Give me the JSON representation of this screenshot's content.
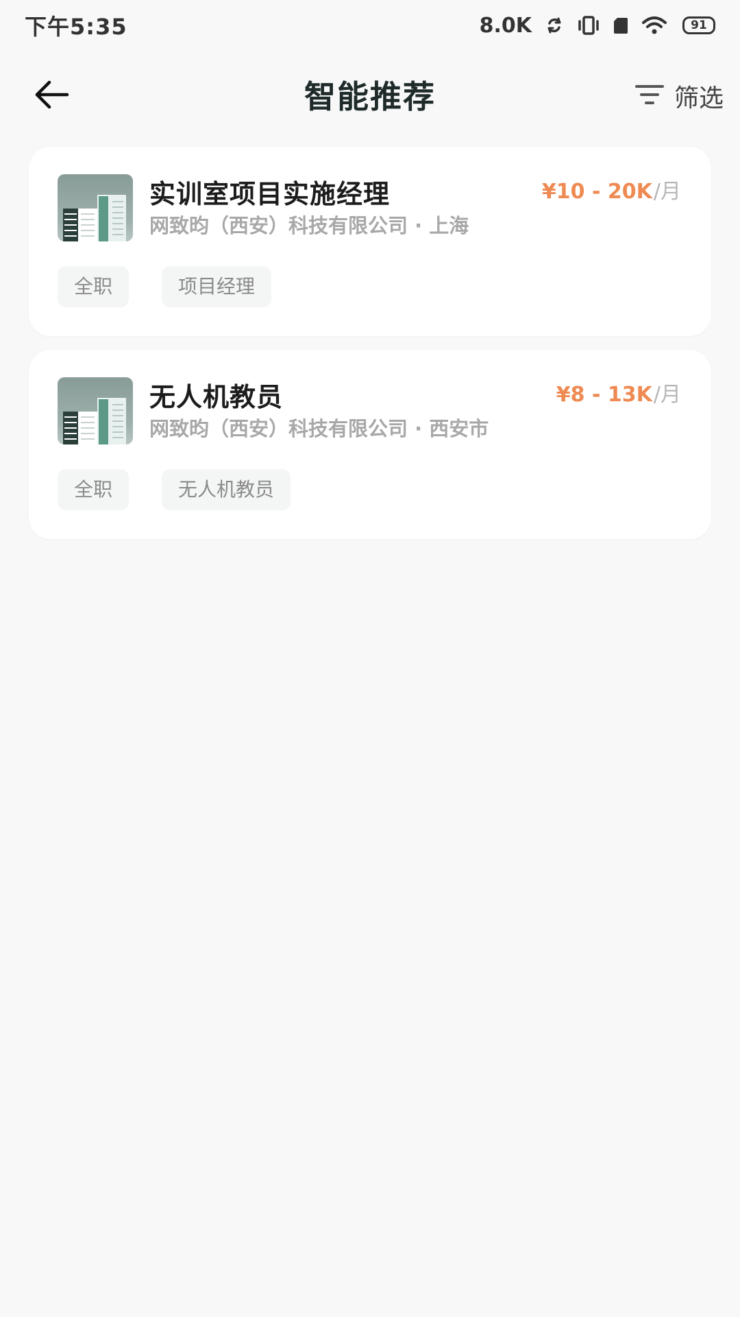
{
  "status_bar": {
    "time": "下午5:35",
    "net_speed": "8.0K",
    "battery_level": "91",
    "icons": [
      "sync-icon",
      "vibrate-icon",
      "sim-icon",
      "wifi-icon",
      "battery-icon"
    ]
  },
  "header": {
    "title": "智能推荐",
    "back_icon": "arrow-left-icon",
    "filter_icon": "filter-icon",
    "filter_label": "筛选"
  },
  "jobs": [
    {
      "title": "实训室项目实施经理",
      "company": "网致昀（西安）科技有限公司 · 上海",
      "salary": "¥10 - 20K",
      "salary_unit": "/月",
      "tags": [
        "全职",
        "项目经理"
      ],
      "logo_icon": "building-logo-icon"
    },
    {
      "title": "无人机教员",
      "company": "网致昀（西安）科技有限公司 · 西安市",
      "salary": "¥8 - 13K",
      "salary_unit": "/月",
      "tags": [
        "全职",
        "无人机教员"
      ],
      "logo_icon": "building-logo-icon"
    }
  ],
  "colors": {
    "background": "#f8f8f8",
    "card": "#ffffff",
    "salary": "#ee8a52",
    "title": "#1f2a2a",
    "muted": "#a8a8a8",
    "tag_bg": "#f4f5f5"
  }
}
